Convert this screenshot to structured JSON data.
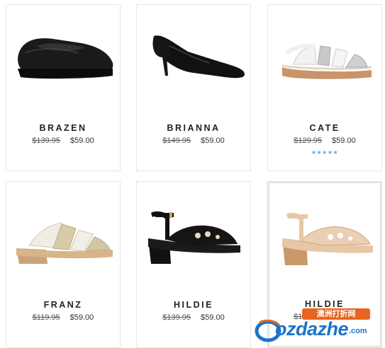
{
  "products": [
    {
      "name": "BRAZEN",
      "old_price": "$139.95",
      "price": "$59.00",
      "image": "black-leather-loafer"
    },
    {
      "name": "BRIANNA",
      "old_price": "$149.95",
      "price": "$59.00",
      "image": "black-pump-heel"
    },
    {
      "name": "CATE",
      "old_price": "$129.95",
      "price": "$59.00",
      "rating": "★★★★★",
      "image": "white-silver-strappy-sandal"
    },
    {
      "name": "FRANZ",
      "old_price": "$119.95",
      "price": "$59.00",
      "image": "white-gold-wedge-sandal"
    },
    {
      "name": "HILDIE",
      "old_price": "$139.95",
      "price": "$59.00",
      "image": "black-cutout-wedge-sandal"
    },
    {
      "name": "HILDIE",
      "old_price": "$139.95",
      "price": "$59.00",
      "image": "nude-cutout-wedge-sandal"
    }
  ],
  "watermark": {
    "badge": "澳洲打折网",
    "brand": "ozdazhe",
    "suffix": ".com"
  },
  "colors": {
    "rating_star": "#5aaee0",
    "watermark_blue": "#1d73c9",
    "watermark_orange": "#e9641e"
  }
}
